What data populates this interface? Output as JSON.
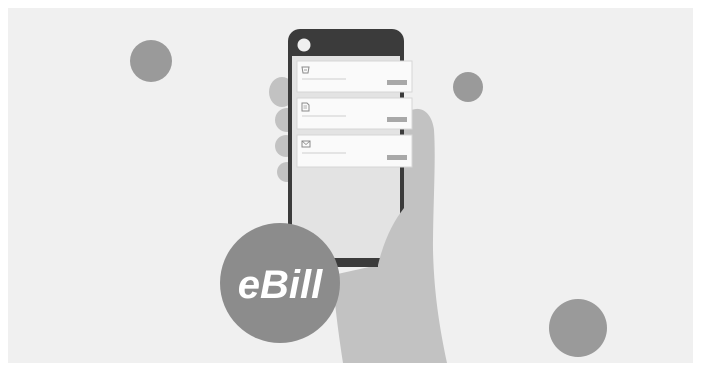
{
  "badge": {
    "label": "eBill"
  },
  "icons": {
    "card_1": "invoice-icon",
    "card_2": "document-icon",
    "card_3": "envelope-icon"
  },
  "colors": {
    "background": "#f0f0f0",
    "circle": "#9a9a9a",
    "hand": "#c2c2c2",
    "phone_body": "#3b3b3b",
    "phone_screen": "#e3e3e3",
    "card": "#fafafa",
    "card_button": "#a8a8a8",
    "badge": "#8c8c8c"
  }
}
